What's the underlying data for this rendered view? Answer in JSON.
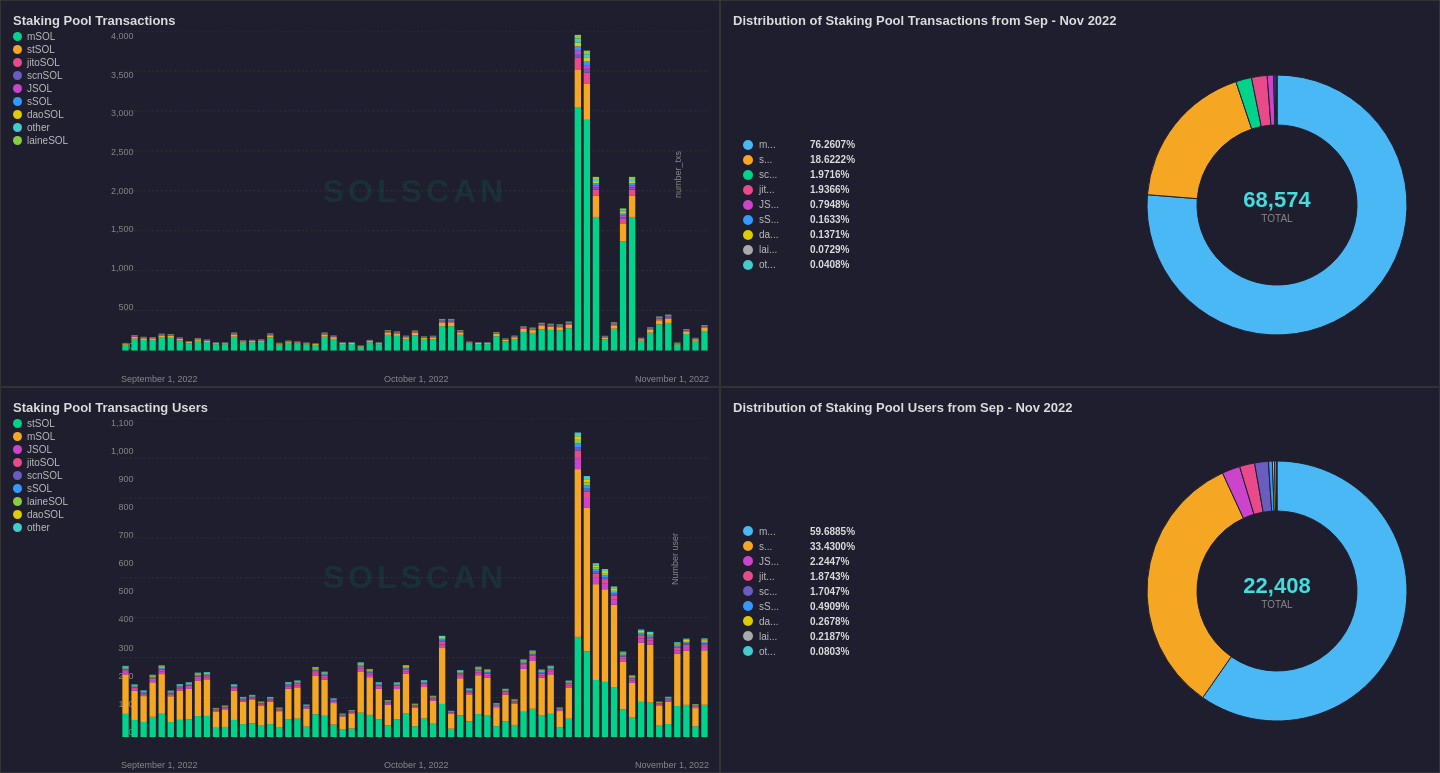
{
  "panel1": {
    "title": "Staking Pool Transactions",
    "y_axis_label": "number_txs",
    "watermark": "SOLSCAN",
    "x_labels": [
      "September 1, 2022",
      "October 1, 2022",
      "November 1, 2022"
    ],
    "y_ticks": [
      "4,000",
      "3,500",
      "3,000",
      "2,500",
      "2,000",
      "1,500",
      "1,000",
      "500",
      "0"
    ],
    "legend": [
      {
        "label": "mSOL",
        "color": "#00d48a"
      },
      {
        "label": "stSOL",
        "color": "#f5a623"
      },
      {
        "label": "jitoSOL",
        "color": "#e94b8a"
      },
      {
        "label": "scnSOL",
        "color": "#6b5cbf"
      },
      {
        "label": "JSOL",
        "color": "#cc44cc"
      },
      {
        "label": "sSOL",
        "color": "#3399ff"
      },
      {
        "label": "daoSOL",
        "color": "#ddcc00"
      },
      {
        "label": "other",
        "color": "#44cccc"
      },
      {
        "label": "laineSOL",
        "color": "#88cc44"
      }
    ]
  },
  "panel2": {
    "title": "Distribution of Staking Pool Transactions from Sep - Nov 2022",
    "total": "68,574",
    "total_label": "TOTAL",
    "legend": [
      {
        "label": "m...",
        "pct": "76.2607%",
        "color": "#4ab8f5"
      },
      {
        "label": "s...",
        "pct": "18.6222%",
        "color": "#f5a623"
      },
      {
        "label": "sc...",
        "pct": "1.9716%",
        "color": "#00d48a"
      },
      {
        "label": "jit...",
        "pct": "1.9366%",
        "color": "#e94b8a"
      },
      {
        "label": "JS...",
        "pct": "0.7948%",
        "color": "#cc44cc"
      },
      {
        "label": "sS...",
        "pct": "0.1633%",
        "color": "#3399ff"
      },
      {
        "label": "da...",
        "pct": "0.1371%",
        "color": "#ddcc00"
      },
      {
        "label": "lai...",
        "pct": "0.0729%",
        "color": "#aaaaaa"
      },
      {
        "label": "ot...",
        "pct": "0.0408%",
        "color": "#44cccc"
      }
    ],
    "segments": [
      {
        "pct": 76.2607,
        "color": "#4ab8f5"
      },
      {
        "pct": 18.6222,
        "color": "#f5a623"
      },
      {
        "pct": 1.9716,
        "color": "#00d48a"
      },
      {
        "pct": 1.9366,
        "color": "#e94b8a"
      },
      {
        "pct": 0.7948,
        "color": "#cc44cc"
      },
      {
        "pct": 0.1633,
        "color": "#3399ff"
      },
      {
        "pct": 0.1371,
        "color": "#ddcc00"
      },
      {
        "pct": 0.0729,
        "color": "#aaaaaa"
      },
      {
        "pct": 0.0408,
        "color": "#44cccc"
      }
    ]
  },
  "panel3": {
    "title": "Staking Pool Transacting Users",
    "y_axis_label": "Number user",
    "watermark": "SOLSCAN",
    "x_labels": [
      "September 1, 2022",
      "October 1, 2022",
      "November 1, 2022"
    ],
    "y_ticks": [
      "1,100",
      "1,000",
      "900",
      "800",
      "700",
      "600",
      "500",
      "400",
      "300",
      "200",
      "100",
      "0"
    ],
    "legend": [
      {
        "label": "stSOL",
        "color": "#00d48a"
      },
      {
        "label": "mSOL",
        "color": "#f5a623"
      },
      {
        "label": "JSOL",
        "color": "#cc44cc"
      },
      {
        "label": "jitoSOL",
        "color": "#e94b8a"
      },
      {
        "label": "scnSOL",
        "color": "#6b5cbf"
      },
      {
        "label": "sSOL",
        "color": "#3399ff"
      },
      {
        "label": "laineSOL",
        "color": "#88cc44"
      },
      {
        "label": "daoSOL",
        "color": "#ddcc00"
      },
      {
        "label": "other",
        "color": "#44cccc"
      }
    ]
  },
  "panel4": {
    "title": "Distribution of Staking Pool Users from Sep - Nov 2022",
    "total": "22,408",
    "total_label": "TOTAL",
    "legend": [
      {
        "label": "m...",
        "pct": "59.6885%",
        "color": "#4ab8f5"
      },
      {
        "label": "s...",
        "pct": "33.4300%",
        "color": "#f5a623"
      },
      {
        "label": "JS...",
        "pct": "2.2447%",
        "color": "#cc44cc"
      },
      {
        "label": "jit...",
        "pct": "1.8743%",
        "color": "#e94b8a"
      },
      {
        "label": "sc...",
        "pct": "1.7047%",
        "color": "#6b5cbf"
      },
      {
        "label": "sS...",
        "pct": "0.4909%",
        "color": "#3399ff"
      },
      {
        "label": "da...",
        "pct": "0.2678%",
        "color": "#ddcc00"
      },
      {
        "label": "lai...",
        "pct": "0.2187%",
        "color": "#aaaaaa"
      },
      {
        "label": "ot...",
        "pct": "0.0803%",
        "color": "#44cccc"
      }
    ],
    "segments": [
      {
        "pct": 59.6885,
        "color": "#4ab8f5"
      },
      {
        "pct": 33.43,
        "color": "#f5a623"
      },
      {
        "pct": 2.2447,
        "color": "#cc44cc"
      },
      {
        "pct": 1.8743,
        "color": "#e94b8a"
      },
      {
        "pct": 1.7047,
        "color": "#6b5cbf"
      },
      {
        "pct": 0.4909,
        "color": "#3399ff"
      },
      {
        "pct": 0.2678,
        "color": "#ddcc00"
      },
      {
        "pct": 0.2187,
        "color": "#aaaaaa"
      },
      {
        "pct": 0.0803,
        "color": "#44cccc"
      }
    ]
  }
}
